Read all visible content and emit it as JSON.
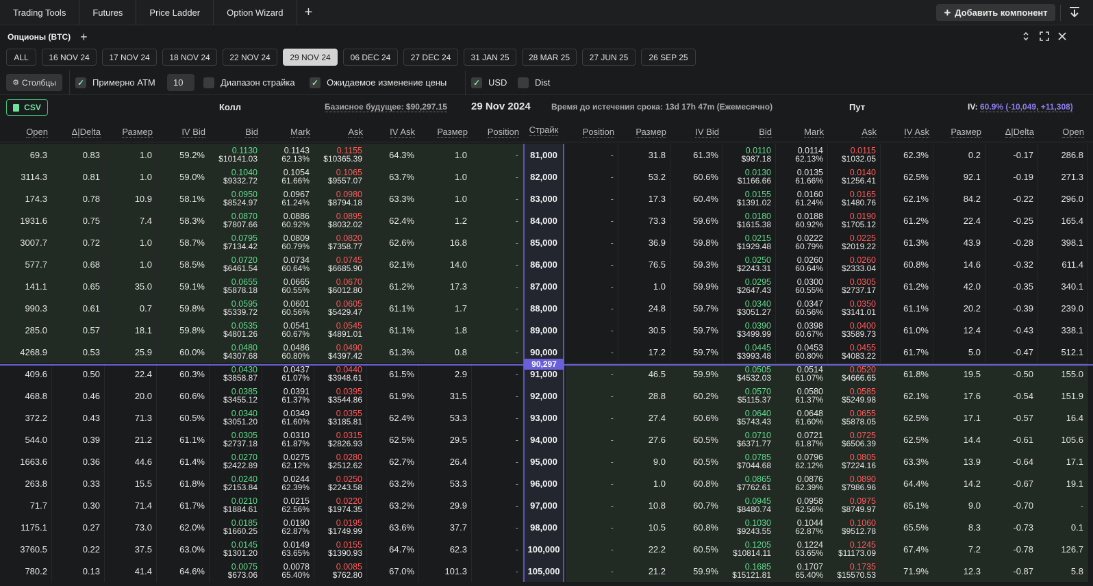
{
  "topbar": {
    "tabs": [
      "Trading Tools",
      "Futures",
      "Price Ladder",
      "Option Wizard"
    ],
    "add_component": "Добавить компонент"
  },
  "panel": {
    "title": "Опционы (BTC)"
  },
  "expiries": [
    "ALL",
    "16 NOV 24",
    "17 NOV 24",
    "18 NOV 24",
    "22 NOV 24",
    "29 NOV 24",
    "06 DEC 24",
    "27 DEC 24",
    "31 JAN 25",
    "28 MAR 25",
    "27 JUN 25",
    "26 SEP 25"
  ],
  "active_expiry": "29 NOV 24",
  "filters": {
    "columns_button": "Столбцы",
    "approx_atm": "Примерно ATM",
    "approx_atm_count": "10",
    "strike_range": "Диапазон страйка",
    "expected_move": "Ожидаемое изменение цены",
    "usd": "USD",
    "dist": "Dist"
  },
  "info": {
    "csv": "CSV",
    "call_label": "Колл",
    "underlying": "Базисное будущее: $90,297.15",
    "expiry_date": "29 Nov 2024",
    "time_to_expiry": "Время до истечения срока: 13d 17h 47m (Ежемесячно)",
    "put_label": "Пут",
    "iv_prefix": "IV:",
    "iv_value": "60.9% (-10,049, +11,308)"
  },
  "columns": {
    "call": [
      "Open",
      "Δ|Delta",
      "Размер",
      "IV Bid",
      "Bid",
      "Mark",
      "Ask",
      "IV Ask",
      "Размер",
      "Position"
    ],
    "strike": "Страйк",
    "put": [
      "Position",
      "Размер",
      "IV Bid",
      "Bid",
      "Mark",
      "Ask",
      "IV Ask",
      "Размер",
      "Δ|Delta",
      "Open"
    ]
  },
  "atm_price": "90,297",
  "rows": [
    {
      "strike": "81,000",
      "c": [
        "69.3",
        "0.83",
        "1.0",
        "59.2%",
        [
          "0.1130",
          "$10141.03"
        ],
        [
          "0.1143",
          "62.13%"
        ],
        [
          "0.1155",
          "$10365.39"
        ],
        "64.3%",
        "1.0",
        "-"
      ],
      "p": [
        "-",
        "31.8",
        "61.3%",
        [
          "0.0110",
          "$987.18"
        ],
        [
          "0.0114",
          "62.13%"
        ],
        [
          "0.0115",
          "$1032.05"
        ],
        "62.3%",
        "0.2",
        "-0.17",
        "286.8"
      ]
    },
    {
      "strike": "82,000",
      "c": [
        "3114.3",
        "0.81",
        "1.0",
        "59.0%",
        [
          "0.1040",
          "$9332.72"
        ],
        [
          "0.1054",
          "61.66%"
        ],
        [
          "0.1065",
          "$9557.07"
        ],
        "63.7%",
        "1.0",
        "-"
      ],
      "p": [
        "-",
        "53.2",
        "60.6%",
        [
          "0.0130",
          "$1166.66"
        ],
        [
          "0.0135",
          "61.66%"
        ],
        [
          "0.0140",
          "$1256.41"
        ],
        "62.5%",
        "92.1",
        "-0.19",
        "271.3"
      ]
    },
    {
      "strike": "83,000",
      "c": [
        "174.3",
        "0.78",
        "10.9",
        "58.1%",
        [
          "0.0950",
          "$8524.97"
        ],
        [
          "0.0967",
          "61.24%"
        ],
        [
          "0.0980",
          "$8794.18"
        ],
        "63.3%",
        "1.0",
        "-"
      ],
      "p": [
        "-",
        "17.3",
        "60.4%",
        [
          "0.0155",
          "$1391.02"
        ],
        [
          "0.0160",
          "61.24%"
        ],
        [
          "0.0165",
          "$1480.76"
        ],
        "62.1%",
        "84.2",
        "-0.22",
        "296.0"
      ]
    },
    {
      "strike": "84,000",
      "c": [
        "1931.6",
        "0.75",
        "7.4",
        "58.3%",
        [
          "0.0870",
          "$7807.66"
        ],
        [
          "0.0886",
          "60.92%"
        ],
        [
          "0.0895",
          "$8032.02"
        ],
        "62.4%",
        "1.2",
        "-"
      ],
      "p": [
        "-",
        "73.3",
        "59.6%",
        [
          "0.0180",
          "$1615.38"
        ],
        [
          "0.0188",
          "60.92%"
        ],
        [
          "0.0190",
          "$1705.12"
        ],
        "61.2%",
        "22.4",
        "-0.25",
        "165.4"
      ]
    },
    {
      "strike": "85,000",
      "c": [
        "3007.7",
        "0.72",
        "1.0",
        "58.7%",
        [
          "0.0795",
          "$7134.42"
        ],
        [
          "0.0809",
          "60.79%"
        ],
        [
          "0.0820",
          "$7358.77"
        ],
        "62.6%",
        "16.8",
        "-"
      ],
      "p": [
        "-",
        "36.9",
        "59.8%",
        [
          "0.0215",
          "$1929.48"
        ],
        [
          "0.0222",
          "60.79%"
        ],
        [
          "0.0225",
          "$2019.22"
        ],
        "61.3%",
        "43.9",
        "-0.28",
        "398.1"
      ]
    },
    {
      "strike": "86,000",
      "c": [
        "577.7",
        "0.68",
        "1.0",
        "58.5%",
        [
          "0.0720",
          "$6461.54"
        ],
        [
          "0.0734",
          "60.64%"
        ],
        [
          "0.0745",
          "$6685.90"
        ],
        "62.1%",
        "14.0",
        "-"
      ],
      "p": [
        "-",
        "76.5",
        "59.3%",
        [
          "0.0250",
          "$2243.31"
        ],
        [
          "0.0260",
          "60.64%"
        ],
        [
          "0.0260",
          "$2333.04"
        ],
        "60.8%",
        "14.6",
        "-0.32",
        "611.4"
      ]
    },
    {
      "strike": "87,000",
      "c": [
        "141.1",
        "0.65",
        "35.0",
        "59.1%",
        [
          "0.0655",
          "$5878.18"
        ],
        [
          "0.0665",
          "60.55%"
        ],
        [
          "0.0670",
          "$6012.80"
        ],
        "61.2%",
        "17.3",
        "-"
      ],
      "p": [
        "-",
        "1.0",
        "59.9%",
        [
          "0.0295",
          "$2647.43"
        ],
        [
          "0.0300",
          "60.55%"
        ],
        [
          "0.0305",
          "$2737.17"
        ],
        "61.2%",
        "42.0",
        "-0.35",
        "340.1"
      ]
    },
    {
      "strike": "88,000",
      "c": [
        "990.3",
        "0.61",
        "0.7",
        "59.8%",
        [
          "0.0595",
          "$5339.72"
        ],
        [
          "0.0601",
          "60.56%"
        ],
        [
          "0.0605",
          "$5429.47"
        ],
        "61.1%",
        "1.7",
        "-"
      ],
      "p": [
        "-",
        "24.8",
        "59.7%",
        [
          "0.0340",
          "$3051.27"
        ],
        [
          "0.0347",
          "60.56%"
        ],
        [
          "0.0350",
          "$3141.01"
        ],
        "61.1%",
        "20.2",
        "-0.39",
        "239.0"
      ]
    },
    {
      "strike": "89,000",
      "c": [
        "285.0",
        "0.57",
        "18.1",
        "59.8%",
        [
          "0.0535",
          "$4801.26"
        ],
        [
          "0.0541",
          "60.67%"
        ],
        [
          "0.0545",
          "$4891.01"
        ],
        "61.1%",
        "1.8",
        "-"
      ],
      "p": [
        "-",
        "30.5",
        "59.7%",
        [
          "0.0390",
          "$3499.99"
        ],
        [
          "0.0398",
          "60.67%"
        ],
        [
          "0.0400",
          "$3589.73"
        ],
        "61.0%",
        "12.4",
        "-0.43",
        "338.1"
      ]
    },
    {
      "strike": "90,000",
      "c": [
        "4268.9",
        "0.53",
        "25.9",
        "60.0%",
        [
          "0.0480",
          "$4307.68"
        ],
        [
          "0.0486",
          "60.80%"
        ],
        [
          "0.0490",
          "$4397.42"
        ],
        "61.3%",
        "0.8",
        "-"
      ],
      "p": [
        "-",
        "17.2",
        "59.7%",
        [
          "0.0445",
          "$3993.48"
        ],
        [
          "0.0453",
          "60.80%"
        ],
        [
          "0.0455",
          "$4083.22"
        ],
        "61.7%",
        "5.0",
        "-0.47",
        "512.1"
      ]
    },
    {
      "strike": "91,000",
      "c": [
        "409.6",
        "0.50",
        "22.4",
        "60.3%",
        [
          "0.0430",
          "$3858.87"
        ],
        [
          "0.0437",
          "61.07%"
        ],
        [
          "0.0440",
          "$3948.61"
        ],
        "61.5%",
        "2.9",
        "-"
      ],
      "p": [
        "-",
        "46.5",
        "59.9%",
        [
          "0.0505",
          "$4532.03"
        ],
        [
          "0.0514",
          "61.07%"
        ],
        [
          "0.0520",
          "$4666.65"
        ],
        "61.8%",
        "19.5",
        "-0.50",
        "155.0"
      ]
    },
    {
      "strike": "92,000",
      "c": [
        "468.8",
        "0.46",
        "20.0",
        "60.6%",
        [
          "0.0385",
          "$3455.12"
        ],
        [
          "0.0391",
          "61.37%"
        ],
        [
          "0.0395",
          "$3544.86"
        ],
        "61.9%",
        "31.5",
        "-"
      ],
      "p": [
        "-",
        "28.8",
        "60.2%",
        [
          "0.0570",
          "$5115.37"
        ],
        [
          "0.0580",
          "61.37%"
        ],
        [
          "0.0585",
          "$5249.98"
        ],
        "62.1%",
        "17.6",
        "-0.54",
        "151.9"
      ]
    },
    {
      "strike": "93,000",
      "c": [
        "372.2",
        "0.43",
        "71.3",
        "60.5%",
        [
          "0.0340",
          "$3051.20"
        ],
        [
          "0.0349",
          "61.60%"
        ],
        [
          "0.0355",
          "$3185.81"
        ],
        "62.4%",
        "53.3",
        "-"
      ],
      "p": [
        "-",
        "27.4",
        "60.6%",
        [
          "0.0640",
          "$5743.43"
        ],
        [
          "0.0648",
          "61.60%"
        ],
        [
          "0.0655",
          "$5878.05"
        ],
        "62.5%",
        "17.1",
        "-0.57",
        "16.4"
      ]
    },
    {
      "strike": "94,000",
      "c": [
        "544.0",
        "0.39",
        "21.2",
        "61.1%",
        [
          "0.0305",
          "$2737.18"
        ],
        [
          "0.0310",
          "61.87%"
        ],
        [
          "0.0315",
          "$2826.93"
        ],
        "62.5%",
        "29.5",
        "-"
      ],
      "p": [
        "-",
        "27.6",
        "60.5%",
        [
          "0.0710",
          "$6371.77"
        ],
        [
          "0.0721",
          "61.87%"
        ],
        [
          "0.0725",
          "$6506.39"
        ],
        "62.5%",
        "14.4",
        "-0.61",
        "105.6"
      ]
    },
    {
      "strike": "95,000",
      "c": [
        "1663.6",
        "0.36",
        "44.6",
        "61.4%",
        [
          "0.0270",
          "$2422.89"
        ],
        [
          "0.0275",
          "62.12%"
        ],
        [
          "0.0280",
          "$2512.62"
        ],
        "62.7%",
        "26.4",
        "-"
      ],
      "p": [
        "-",
        "9.0",
        "60.5%",
        [
          "0.0785",
          "$7044.68"
        ],
        [
          "0.0796",
          "62.12%"
        ],
        [
          "0.0805",
          "$7224.16"
        ],
        "63.3%",
        "13.9",
        "-0.64",
        "17.1"
      ]
    },
    {
      "strike": "96,000",
      "c": [
        "263.8",
        "0.33",
        "15.5",
        "61.8%",
        [
          "0.0240",
          "$2153.84"
        ],
        [
          "0.0244",
          "62.39%"
        ],
        [
          "0.0250",
          "$2243.58"
        ],
        "63.2%",
        "53.3",
        "-"
      ],
      "p": [
        "-",
        "1.0",
        "60.8%",
        [
          "0.0865",
          "$7762.61"
        ],
        [
          "0.0876",
          "62.39%"
        ],
        [
          "0.0890",
          "$7986.96"
        ],
        "64.4%",
        "14.2",
        "-0.67",
        "19.1"
      ]
    },
    {
      "strike": "97,000",
      "c": [
        "71.7",
        "0.30",
        "71.4",
        "61.7%",
        [
          "0.0210",
          "$1884.61"
        ],
        [
          "0.0215",
          "62.56%"
        ],
        [
          "0.0220",
          "$1974.35"
        ],
        "63.2%",
        "29.9",
        "-"
      ],
      "p": [
        "-",
        "10.8",
        "60.7%",
        [
          "0.0945",
          "$8480.74"
        ],
        [
          "0.0958",
          "62.56%"
        ],
        [
          "0.0975",
          "$8749.97"
        ],
        "65.1%",
        "9.0",
        "-0.70",
        "-"
      ]
    },
    {
      "strike": "98,000",
      "c": [
        "1175.1",
        "0.27",
        "73.0",
        "62.0%",
        [
          "0.0185",
          "$1660.25"
        ],
        [
          "0.0190",
          "62.87%"
        ],
        [
          "0.0195",
          "$1749.99"
        ],
        "63.6%",
        "37.7",
        "-"
      ],
      "p": [
        "-",
        "10.5",
        "60.8%",
        [
          "0.1030",
          "$9243.55"
        ],
        [
          "0.1044",
          "62.87%"
        ],
        [
          "0.1060",
          "$9512.78"
        ],
        "65.5%",
        "8.3",
        "-0.73",
        "0.1"
      ]
    },
    {
      "strike": "100,000",
      "c": [
        "3760.5",
        "0.22",
        "37.5",
        "63.0%",
        [
          "0.0145",
          "$1301.20"
        ],
        [
          "0.0149",
          "63.65%"
        ],
        [
          "0.0155",
          "$1390.93"
        ],
        "64.7%",
        "62.3",
        "-"
      ],
      "p": [
        "-",
        "22.2",
        "60.5%",
        [
          "0.1205",
          "$10814.11"
        ],
        [
          "0.1224",
          "63.65%"
        ],
        [
          "0.1245",
          "$11173.09"
        ],
        "67.4%",
        "7.2",
        "-0.78",
        "126.7"
      ]
    },
    {
      "strike": "105,000",
      "c": [
        "780.2",
        "0.13",
        "41.4",
        "64.6%",
        [
          "0.0075",
          "$673.06"
        ],
        [
          "0.0078",
          "65.40%"
        ],
        [
          "0.0085",
          "$762.80"
        ],
        "67.0%",
        "101.3",
        "-"
      ],
      "p": [
        "-",
        "21.2",
        "59.9%",
        [
          "0.1685",
          "$15121.81"
        ],
        [
          "0.1707",
          "65.40%"
        ],
        [
          "0.1735",
          "$15570.53"
        ],
        "71.9%",
        "12.3",
        "-0.87",
        "5.8"
      ]
    }
  ],
  "colors": {
    "bid": "#5fdc8b",
    "ask": "#ff5a5a",
    "atm": "#6a5fd8",
    "itm_bg": "#222a24",
    "otm_bg": "#1a1b1c"
  }
}
